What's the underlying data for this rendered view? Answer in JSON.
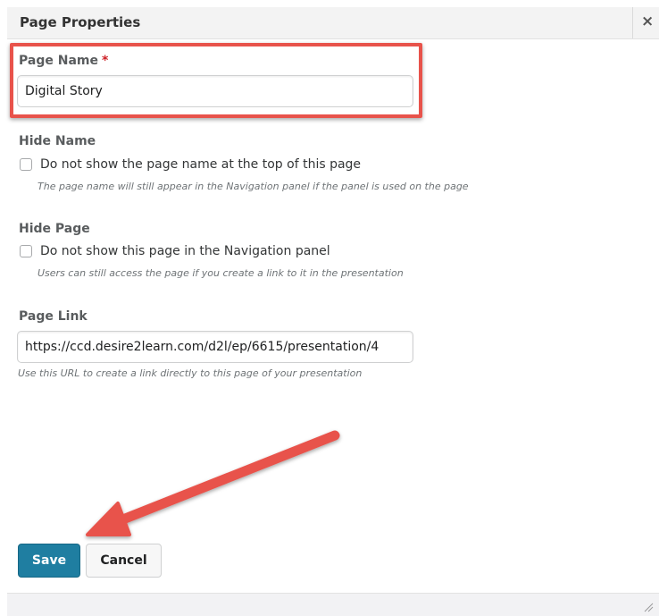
{
  "dialog": {
    "title": "Page Properties",
    "close_glyph": "×"
  },
  "page_name": {
    "label": "Page Name",
    "required_marker": "*",
    "value": "Digital Story"
  },
  "hide_name": {
    "label": "Hide Name",
    "checkbox_label": "Do not show the page name at the top of this page",
    "checked": false,
    "help": "The page name will still appear in the Navigation panel if the panel is used on the page"
  },
  "hide_page": {
    "label": "Hide Page",
    "checkbox_label": "Do not show this page in the Navigation panel",
    "checked": false,
    "help": "Users can still access the page if you create a link to it in the presentation"
  },
  "page_link": {
    "label": "Page Link",
    "value": "https://ccd.desire2learn.com/d2l/ep/6615/presentation/4",
    "help": "Use this URL to create a link directly to this page of your presentation"
  },
  "buttons": {
    "save": "Save",
    "cancel": "Cancel"
  },
  "annotation": {
    "highlight_color": "#e8534b",
    "arrow_color": "#e8534b"
  },
  "colors": {
    "primary": "#1f7ea1",
    "required": "#cd2026"
  },
  "icons": {
    "close": "close-icon",
    "resize": "resize-grip-icon",
    "arrow": "annotation-arrow-icon"
  }
}
